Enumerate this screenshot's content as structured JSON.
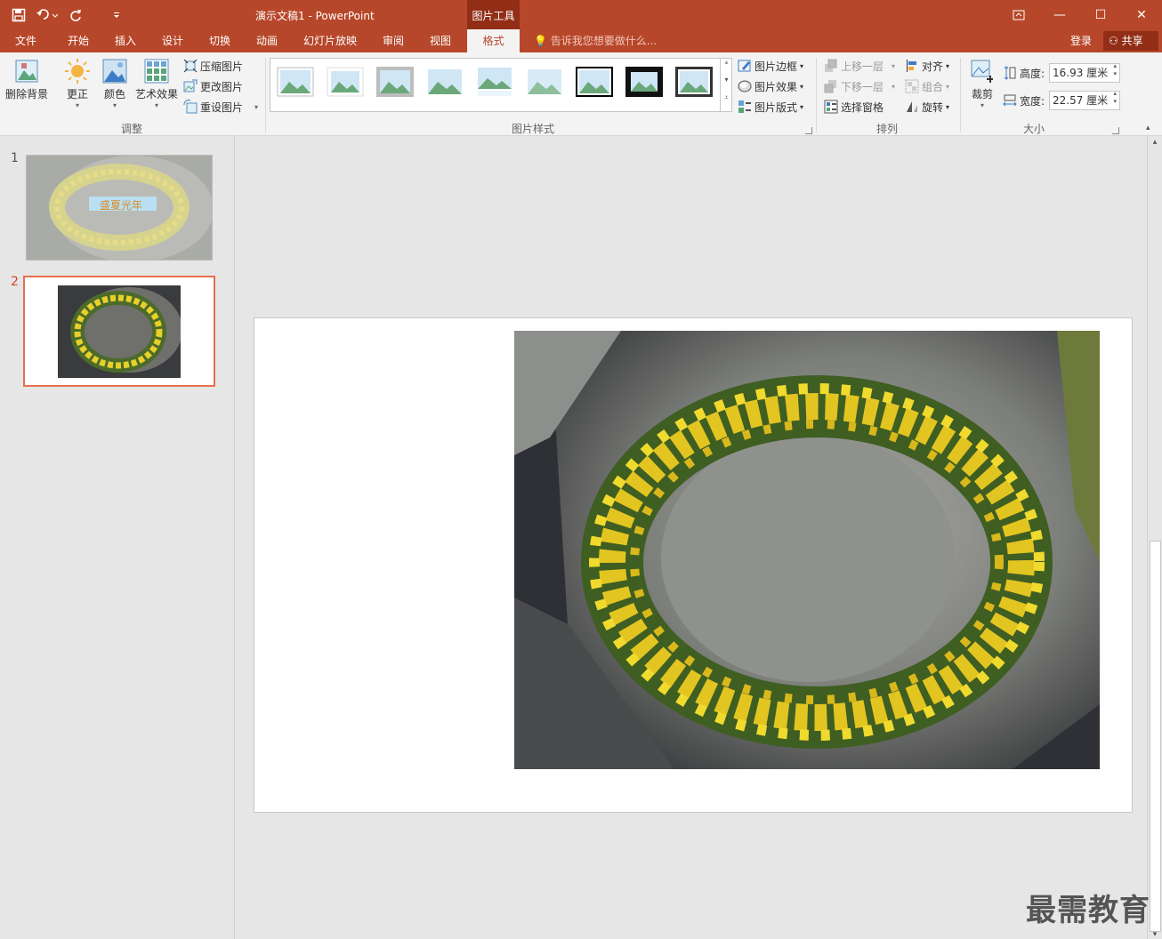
{
  "window": {
    "title": "演示文稿1 - PowerPoint",
    "context_tab_group": "图片工具",
    "minimize_symbol": "—",
    "maximize_symbol": "☐",
    "close_symbol": "✕",
    "restore_symbol": "⧉"
  },
  "qat": {
    "save_icon": "save-icon",
    "undo_icon": "undo-icon",
    "redo_icon": "redo-icon",
    "customize_icon": "chevron-down-icon"
  },
  "tabs": [
    "文件",
    "开始",
    "插入",
    "设计",
    "切换",
    "动画",
    "幻灯片放映",
    "审阅",
    "视图",
    "格式"
  ],
  "active_tab": "格式",
  "tell_me": "告诉我您想要做什么...",
  "account": {
    "login": "登录",
    "share": "共享"
  },
  "ribbon": {
    "adjust": {
      "label": "调整",
      "remove_bg": "删除背景",
      "corrections": "更正",
      "color": "颜色",
      "artistic": "艺术效果",
      "compress": "压缩图片",
      "change": "更改图片",
      "reset": "重设图片"
    },
    "styles": {
      "label": "图片样式",
      "border": "图片边框",
      "effects": "图片效果",
      "layout": "图片版式",
      "gallery_count": 9
    },
    "arrange": {
      "label": "排列",
      "bring_forward": "上移一层",
      "send_backward": "下移一层",
      "selection_pane": "选择窗格",
      "align": "对齐",
      "group": "组合",
      "rotate": "旋转"
    },
    "size": {
      "label": "大小",
      "crop": "裁剪",
      "height_label": "高度:",
      "height_value": "16.93 厘米",
      "width_label": "宽度:",
      "width_value": "22.57 厘米"
    }
  },
  "slides": [
    {
      "number": "1",
      "overlay_text": "盛夏光年",
      "selected": false
    },
    {
      "number": "2",
      "selected": true
    }
  ],
  "colors": {
    "accent": "#b7472a",
    "accent_dark": "#922e16",
    "ribbon_bg": "#f3f3f3",
    "selection_border": "#e8704e"
  },
  "watermark": "最需教育"
}
